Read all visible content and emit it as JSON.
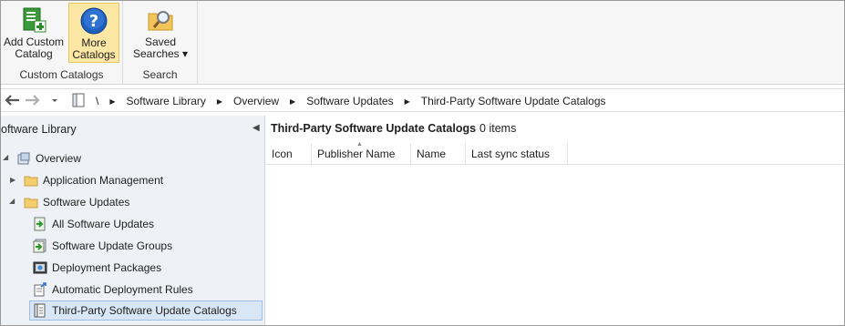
{
  "ribbon": {
    "groups": [
      {
        "label": "Custom Catalogs",
        "buttons": [
          {
            "line1": "Add Custom",
            "line2": "Catalog"
          },
          {
            "line1": "More",
            "line2": "Catalogs"
          }
        ]
      },
      {
        "label": "Search",
        "buttons": [
          {
            "line1": "Saved",
            "line2": "Searches ▾"
          }
        ]
      }
    ]
  },
  "nav": {
    "crumbs": [
      "\\",
      "Software Library",
      "Overview",
      "Software Updates",
      "Third-Party Software Update Catalogs"
    ],
    "separator": "▶"
  },
  "left": {
    "title": "oftware Library",
    "collapse": "◀",
    "items": [
      {
        "label": "Overview"
      },
      {
        "label": "Application Management"
      },
      {
        "label": "Software Updates"
      },
      {
        "label": "All Software Updates"
      },
      {
        "label": "Software Update Groups"
      },
      {
        "label": "Deployment Packages"
      },
      {
        "label": "Automatic Deployment Rules"
      },
      {
        "label": "Third-Party Software Update Catalogs"
      }
    ]
  },
  "right": {
    "title": "Third-Party Software Update Catalogs",
    "count": "0 items",
    "columns": [
      "Icon",
      "Publisher Name",
      "Name",
      "Last sync status"
    ],
    "sort_indicator": "▲"
  },
  "colors": {
    "active_button_bg": "#fce8a4",
    "selected_item_bg": "#d9e6f6",
    "left_pane_bg": "#eef1f6"
  }
}
